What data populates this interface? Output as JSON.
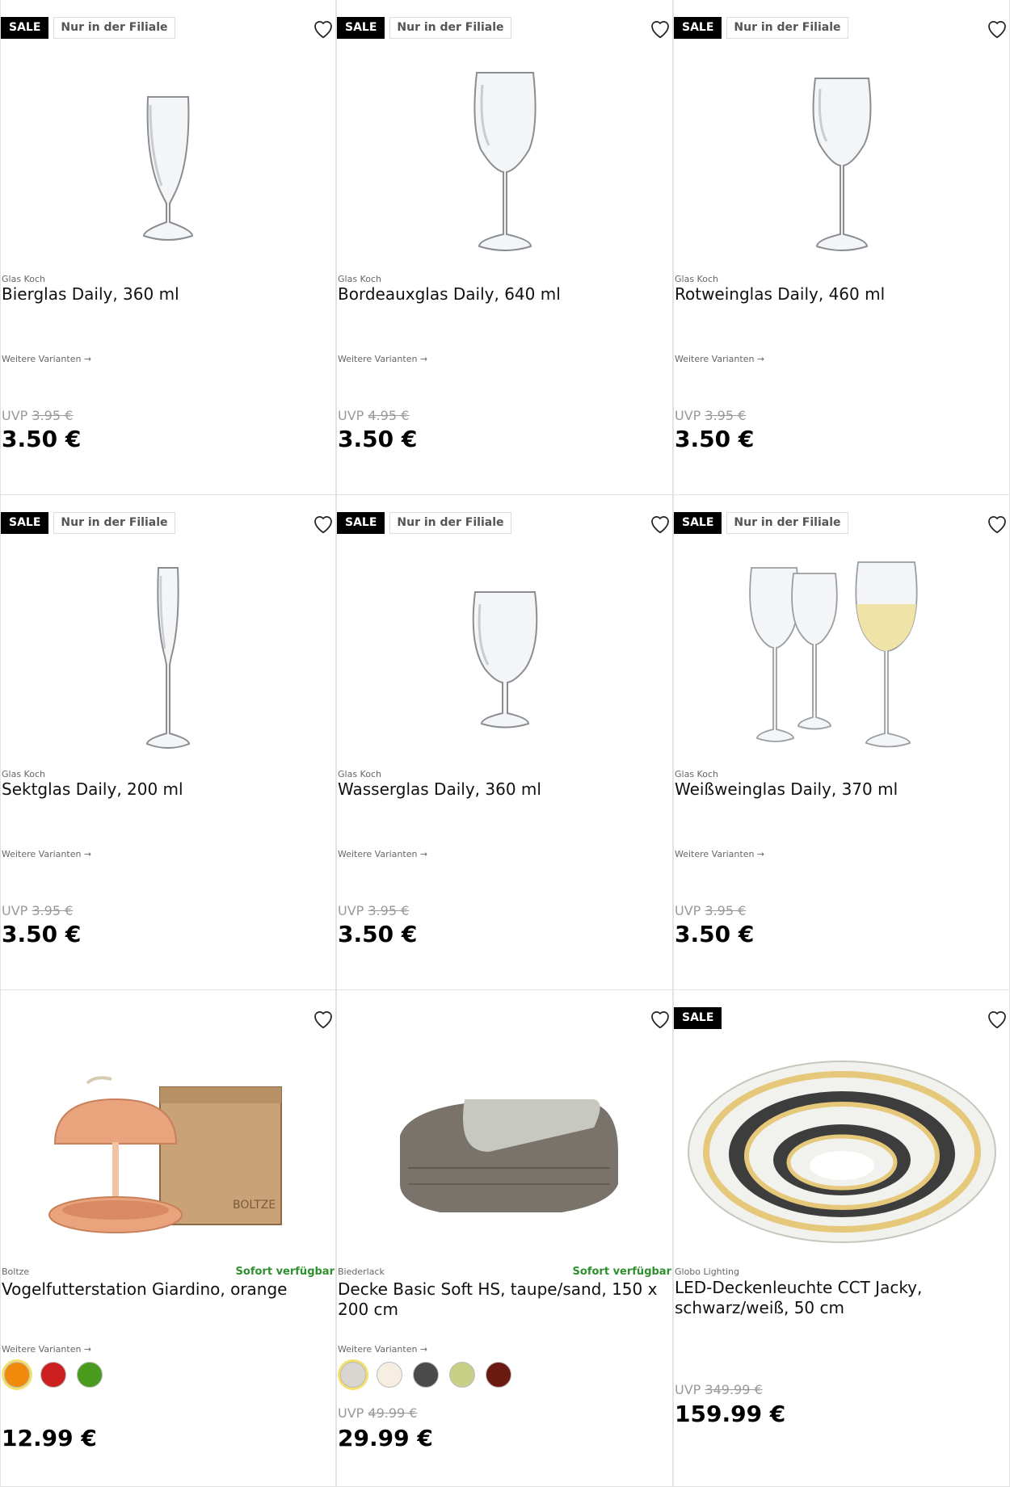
{
  "labels": {
    "sale": "SALE",
    "filiale": "Nur in der Filiale",
    "variants": "Weitere Varianten →",
    "uvp": "UVP",
    "sofort": "Sofort verfügbar"
  },
  "products": [
    {
      "brand": "Glas Koch",
      "title": "Bierglas Daily, 360 ml",
      "uvp": "3.95 €",
      "price": "3.50 €",
      "image": "flute-beer-glass"
    },
    {
      "brand": "Glas Koch",
      "title": "Bordeauxglas Daily, 640 ml",
      "uvp": "4.95 €",
      "price": "3.50 €",
      "image": "bordeaux-glass"
    },
    {
      "brand": "Glas Koch",
      "title": "Rotweinglas Daily, 460 ml",
      "uvp": "3.95 €",
      "price": "3.50 €",
      "image": "red-wine-glass"
    },
    {
      "brand": "Glas Koch",
      "title": "Sektglas Daily, 200 ml",
      "uvp": "3.95 €",
      "price": "3.50 €",
      "image": "champagne-flute"
    },
    {
      "brand": "Glas Koch",
      "title": "Wasserglas Daily, 360 ml",
      "uvp": "3.95 €",
      "price": "3.50 €",
      "image": "water-glass"
    },
    {
      "brand": "Glas Koch",
      "title": "Weißweinglas Daily, 370 ml",
      "uvp": "3.95 €",
      "price": "3.50 €",
      "image": "white-wine-glasses"
    },
    {
      "brand": "Boltze",
      "title": "Vogelfutterstation Giardino, orange",
      "uvp": "",
      "price": "12.99 €",
      "image": "bird-feeder",
      "swatches": [
        "#f08a0c",
        "#cc1f1f",
        "#4a9a1e"
      ]
    },
    {
      "brand": "Biederlack",
      "title": "Decke Basic Soft HS, taupe/sand, 150 x 200 cm",
      "uvp": "49.99 €",
      "price": "29.99 €",
      "image": "blanket",
      "swatches": [
        "#d9d6d2",
        "#f6efe1",
        "#4a4a4a",
        "#c8cf86",
        "#6b1a12"
      ]
    },
    {
      "brand": "Globo Lighting",
      "title": "LED-Deckenleuchte CCT Jacky, schwarz/weiß, 50 cm",
      "uvp": "349.99 €",
      "price": "159.99 €",
      "image": "ceiling-lamp"
    }
  ],
  "colors": {
    "sale_bg": "#000000",
    "available": "#2f8f2f",
    "swatch_selected_ring": "#f3df6a"
  }
}
